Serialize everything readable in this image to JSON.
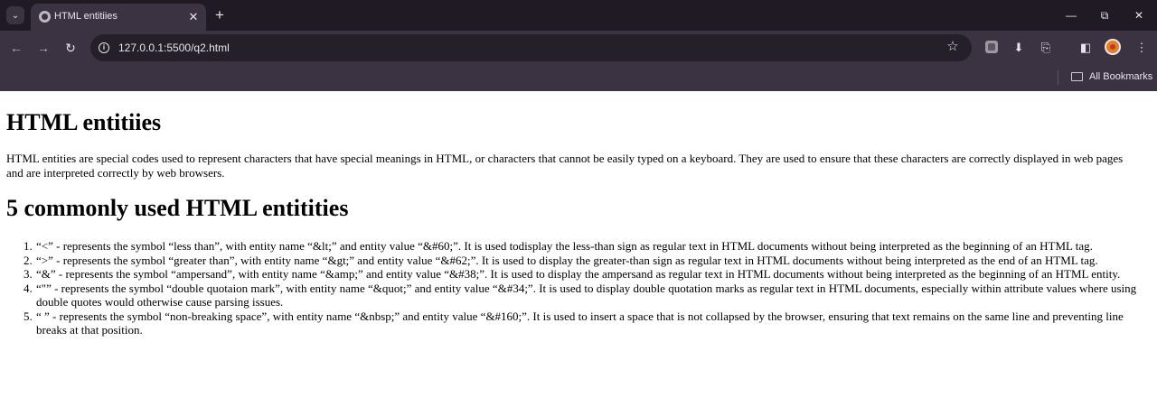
{
  "browser": {
    "tab_title": "HTML entitiies",
    "url": "127.0.0.1:5500/q2.html",
    "bookmarks_label": "All Bookmarks",
    "icons": {
      "tab_menu": "chevron-down-icon",
      "favicon": "globe-icon",
      "tab_close": "close-icon",
      "new_tab": "plus-icon",
      "minimize": "minimize-icon",
      "maximize": "restore-icon",
      "close_window": "close-icon",
      "back": "arrow-left-icon",
      "forward": "arrow-right-icon",
      "reload": "reload-icon",
      "site_info": "info-icon",
      "bookmark": "star-icon",
      "download": "download-icon",
      "extensions": "puzzle-icon",
      "side_panel": "side-panel-icon",
      "menu": "kebab-icon",
      "folder": "folder-icon"
    }
  },
  "page": {
    "heading": "HTML entitiies",
    "intro": "HTML entities are special codes used to represent characters that have special meanings in HTML, or characters that cannot be easily typed on a keyboard. They are used to ensure that these characters are correctly displayed in web pages and are interpreted correctly by web browsers.",
    "subheading": "5 commonly used HTML entitities",
    "items": [
      {
        "num": "1.",
        "text": "“<” - represents the symbol “less than”, with entity name “&lt;” and entity value “&#60;”. It is used todisplay the less-than sign as regular text in HTML documents without being interpreted as the beginning of an HTML tag."
      },
      {
        "num": "2.",
        "text": "“>” - represents the symbol “greater than”, with entity name “&gt;” and entity value “&#62;”. It is used to display the greater-than sign as regular text in HTML documents without being interpreted as the end of an HTML tag."
      },
      {
        "num": "3.",
        "text": "“&” - represents the symbol “ampersand”, with entity name “&amp;” and entity value “&#38;”. It is used to display the ampersand as regular text in HTML documents without being interpreted as the beginning of an HTML entity."
      },
      {
        "num": "4.",
        "text": "“\"” - represents the symbol “double quotaion mark”, with entity name “&quot;” and entity value “&#34;”. It is used to display double quotation marks as regular text in HTML documents, especially within attribute values where using double quotes would otherwise cause parsing issues."
      },
      {
        "num": "5.",
        "text": "“ ” - represents the symbol “non-breaking space”, with entity name “&nbsp;” and entity value “&#160;”. It is used to insert a space that is not collapsed by the browser, ensuring that text remains on the same line and preventing line breaks at that position."
      }
    ]
  }
}
